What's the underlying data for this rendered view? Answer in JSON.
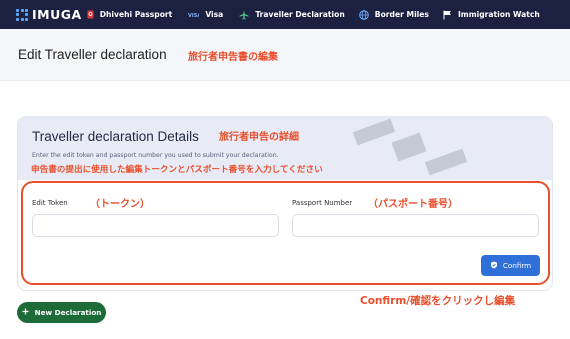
{
  "brand": {
    "name": "IMUGA"
  },
  "nav": {
    "items": [
      {
        "label": "Dhivehi Passport",
        "icon": "passport-icon"
      },
      {
        "label": "Visa",
        "icon": "visa-icon"
      },
      {
        "label": "Traveller Declaration",
        "icon": "plane-icon"
      },
      {
        "label": "Border Miles",
        "icon": "globe-icon"
      },
      {
        "label": "Immigration Watch",
        "icon": "flag-icon"
      }
    ],
    "menu_icon": "hamburger-icon",
    "chat_icon": "chat-icon"
  },
  "header": {
    "title": "Edit Traveller declaration",
    "annotation": "旅行者申告書の編集"
  },
  "card": {
    "title": "Traveller declaration Details",
    "title_annotation": "旅行者申告の詳細",
    "subtitle": "Enter the edit token and passport number you used to submit your declaration.",
    "subtitle_annotation": "申告書の提出に使用した編集トークンとパスポート番号を入力してください"
  },
  "form": {
    "edit_token": {
      "label": "Edit Token",
      "annotation": "（トークン）",
      "value": "",
      "placeholder": ""
    },
    "passport_number": {
      "label": "Passport Number",
      "annotation": "（パスポート番号）",
      "value": "",
      "placeholder": ""
    },
    "confirm_label": "Confirm",
    "confirm_annotation": "Confirm/確認をクリックし編集"
  },
  "actions": {
    "new_declaration_label": "New Declaration"
  },
  "colors": {
    "nav_bg": "#1c2142",
    "annotation": "#e84f2c",
    "confirm_button": "#2e6fd8",
    "new_button": "#1e6b3a"
  }
}
